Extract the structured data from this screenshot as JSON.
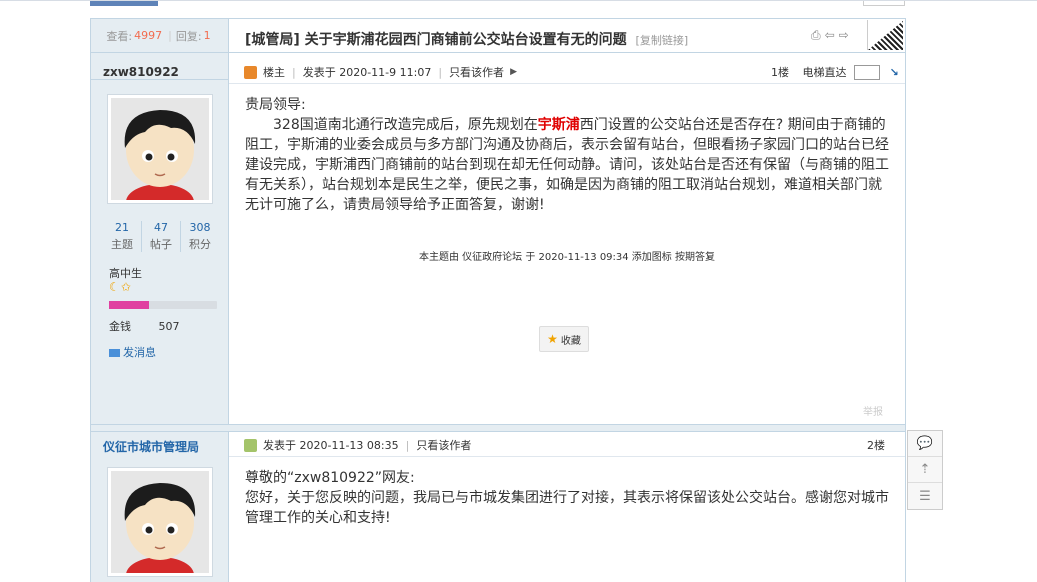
{
  "thread": {
    "views_label": "查看:",
    "views": "4997",
    "replies_label": "回复:",
    "replies": "1",
    "title_prefix": "[城管局]",
    "title": "关于宇斯浦花园西门商铺前公交站台设置有无的问题",
    "copy_link": "[复制链接]"
  },
  "posts": [
    {
      "author": "zxw810922",
      "badge": "楼主",
      "posted": "发表于 2020-11-9 11:07",
      "only_author": "只看该作者",
      "floor": "1楼",
      "elevator": "电梯直达",
      "stats": [
        {
          "value": "21",
          "label": "主题"
        },
        {
          "value": "47",
          "label": "帖子"
        },
        {
          "value": "308",
          "label": "积分"
        }
      ],
      "rank": "高中生",
      "rank_stars": "☾✩",
      "progress": 0.37,
      "money_label": "金钱",
      "money": "507",
      "send_msg": "发消息",
      "greeting": "贵局领导:",
      "body_pre": "328国道南北通行改造完成后，原先规划在",
      "body_kw": "宇斯浦",
      "body_post": "西门设置的公交站台还是否存在? 期间由于商铺的阻工，宇斯浦的业委会成员与多方部门沟通及协商后，表示会留有站台，但眼看扬子家园门口的站台已经建设完成，宇斯浦西门商铺前的站台到现在却无任何动静。请问，该处站台是否还有保留（与商铺的阻工有无关系），站台规划本是民生之举，便民之事，如确是因为商铺的阻工取消站台规划，难道相关部门就无计可施了么，请贵局领导给予正面答复，谢谢!",
      "notice": "本主题由 仪征政府论坛 于 2020-11-13 09:34 添加图标 按期答复",
      "favorite": "收藏",
      "report": "举报"
    },
    {
      "author": "仪征市城市管理局",
      "posted": "发表于 2020-11-13 08:35",
      "only_author": "只看该作者",
      "floor": "2楼",
      "line1": "尊敬的“zxw810922”网友:",
      "line2": "您好，关于您反映的问题，我局已与市城发集团进行了对接，其表示将保留该处公交站台。感谢您对城市管理工作的关心和支持!"
    }
  ],
  "float_bar": [
    "comment-icon",
    "back-to-top-icon",
    "list-icon"
  ],
  "colors": {
    "side_bg": "#e5edf2",
    "border": "#c2d5e3",
    "link": "#2366a8",
    "keyword": "#e00000",
    "count": "#f26c4f"
  }
}
